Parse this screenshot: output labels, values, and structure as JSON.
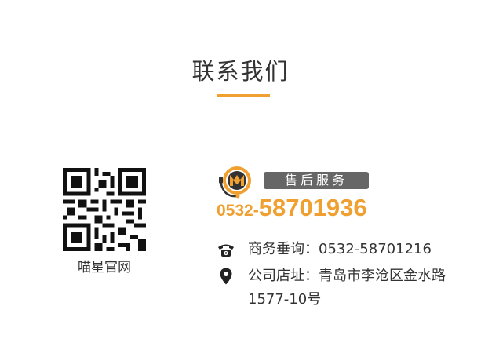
{
  "section": {
    "title": "联系我们"
  },
  "qr": {
    "caption": "喵星官网"
  },
  "service": {
    "badge": "售后服务",
    "phone_area": "0532-",
    "phone_main": "58701936"
  },
  "contacts": {
    "business_label": "商务垂询：",
    "business_value": "0532-58701216",
    "address_label": "公司店址：",
    "address_line1": "青岛市李沧区金水路",
    "address_line2": "1577-10号"
  },
  "colors": {
    "accent": "#f0a030",
    "badge_bg": "#666666",
    "text": "#333333"
  },
  "icons": [
    "telephone-icon",
    "map-pin-icon",
    "brand-logo-icon"
  ]
}
